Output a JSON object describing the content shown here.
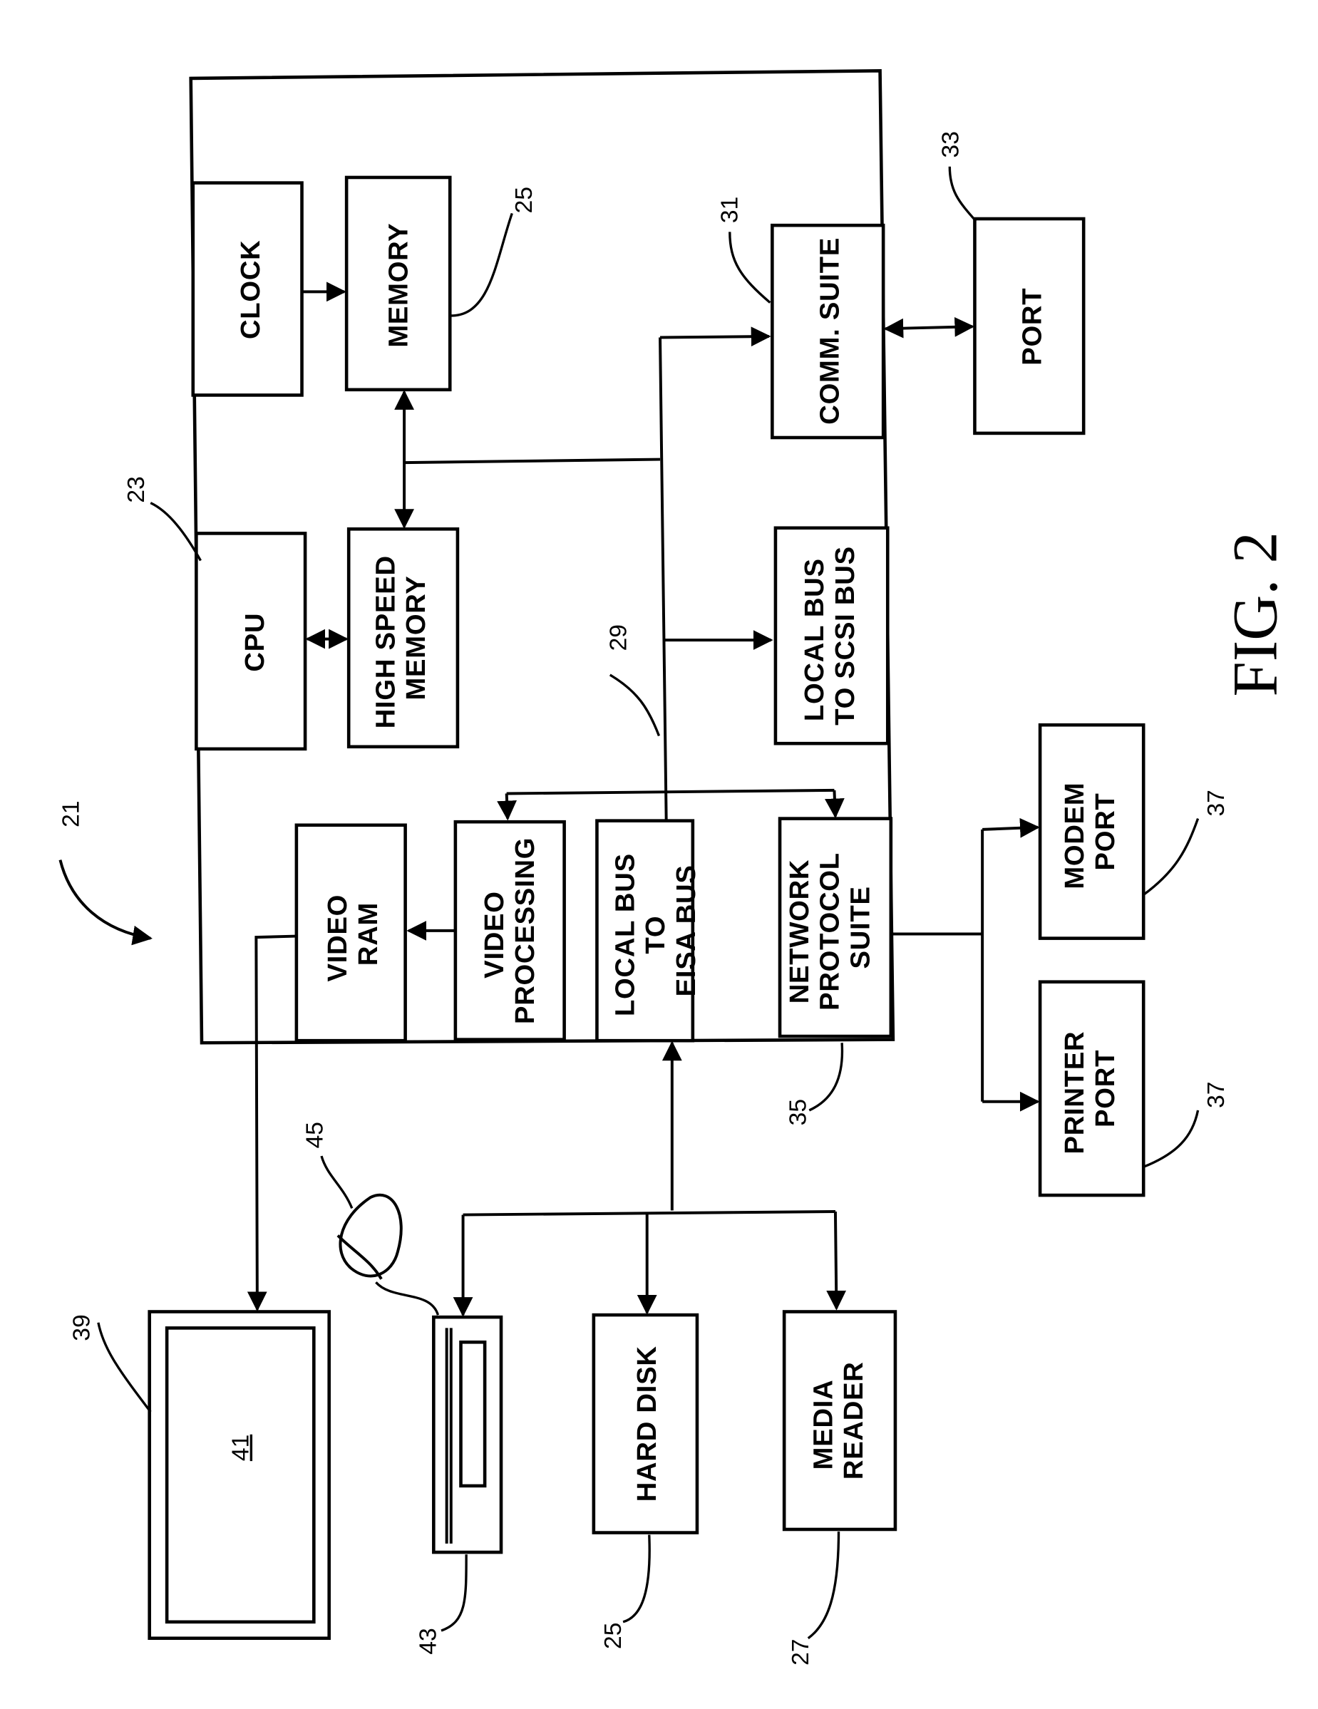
{
  "figure": {
    "title": "FIG. 2",
    "system_ref": "21"
  },
  "blocks": {
    "clock": {
      "lines": [
        "CLOCK"
      ]
    },
    "memory": {
      "lines": [
        "MEMORY"
      ],
      "ref": "25"
    },
    "cpu": {
      "lines": [
        "CPU"
      ],
      "ref": "23"
    },
    "high_speed_memory": {
      "lines": [
        "HIGH SPEED",
        "MEMORY"
      ]
    },
    "comm_suite": {
      "lines": [
        "COMM. SUITE"
      ],
      "ref": "31"
    },
    "port": {
      "lines": [
        "PORT"
      ],
      "ref": "33"
    },
    "local_bus_scsi": {
      "lines": [
        "LOCAL BUS",
        "TO SCSI BUS"
      ]
    },
    "video_ram": {
      "lines": [
        "VIDEO",
        "RAM"
      ]
    },
    "video_processing": {
      "lines": [
        "VIDEO",
        "PROCESSING"
      ]
    },
    "local_bus_eisa": {
      "lines": [
        "LOCAL BUS",
        "TO",
        "EISA BUS"
      ]
    },
    "network_protocol_suite": {
      "lines": [
        "NETWORK",
        "PROTOCOL",
        "SUITE"
      ],
      "ref": "35"
    },
    "modem_port": {
      "lines": [
        "MODEM",
        "PORT"
      ],
      "ref": "37"
    },
    "printer_port": {
      "lines": [
        "PRINTER",
        "PORT"
      ],
      "ref": "37"
    },
    "monitor": {
      "ref": "39",
      "screen_ref": "41"
    },
    "keyboard": {
      "ref": "43"
    },
    "mouse": {
      "ref": "45"
    },
    "hard_disk": {
      "lines": [
        "HARD DISK"
      ],
      "ref": "25"
    },
    "media_reader": {
      "lines": [
        "MEDIA",
        "READER"
      ],
      "ref": "27"
    }
  },
  "bus": {
    "ref": "29"
  }
}
